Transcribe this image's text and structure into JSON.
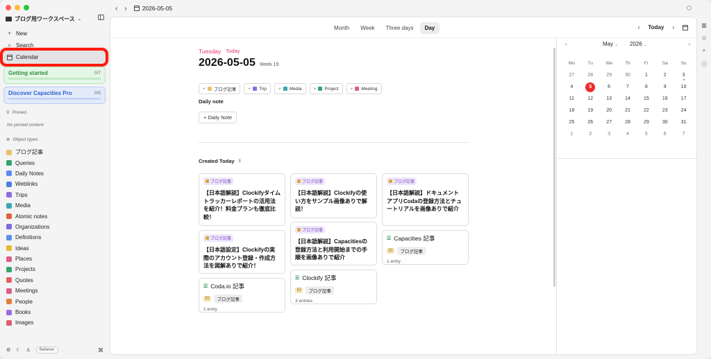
{
  "sidebar": {
    "workspace": "ブログ用ワークスペース",
    "new_label": "New",
    "search_label": "Search",
    "calendar_label": "Calendar",
    "getting_started": {
      "label": "Getting started",
      "count": "0/7"
    },
    "discover": {
      "label": "Discover Capacities Pro",
      "count": "0/5"
    },
    "pinned_header": "Pinned",
    "no_pinned": "No pinned content",
    "object_types_header": "Object types",
    "object_types": [
      {
        "label": "ブログ記事",
        "color": "#e8c170"
      },
      {
        "label": "Queries",
        "color": "#35a56b"
      },
      {
        "label": "Daily Notes",
        "color": "#5b8def"
      },
      {
        "label": "Weblinks",
        "color": "#4d7fe0"
      },
      {
        "label": "Trips",
        "color": "#8b6de0"
      },
      {
        "label": "Media",
        "color": "#3aa9b5"
      },
      {
        "label": "Atomic notes",
        "color": "#e0623c"
      },
      {
        "label": "Organizations",
        "color": "#7d6be0"
      },
      {
        "label": "Definitions",
        "color": "#5b8def"
      },
      {
        "label": "Ideas",
        "color": "#e8b830"
      },
      {
        "label": "Places",
        "color": "#e05c8a"
      },
      {
        "label": "Projects",
        "color": "#35a56b"
      },
      {
        "label": "Quotes",
        "color": "#e06060"
      },
      {
        "label": "Meetings",
        "color": "#e05c8a"
      },
      {
        "label": "People",
        "color": "#e08040"
      },
      {
        "label": "Books",
        "color": "#9b6de0"
      },
      {
        "label": "Images",
        "color": "#e05c70"
      }
    ],
    "footer_badge": "Believer"
  },
  "topbar": {
    "title": "2026-05-05"
  },
  "views": {
    "tabs": [
      "Month",
      "Week",
      "Three days",
      "Day"
    ],
    "active": "Day",
    "today_label": "Today"
  },
  "day": {
    "weekday": "Tuesday",
    "today_badge": "Today",
    "date": "2026-05-05",
    "week": "Week 19",
    "create_chips": [
      {
        "label": "ブログ記事",
        "color": "#e8c170"
      },
      {
        "label": "Trip",
        "color": "#8b6de0"
      },
      {
        "label": "Media",
        "color": "#3aa9b5"
      },
      {
        "label": "Project",
        "color": "#35a56b"
      },
      {
        "label": "Meeting",
        "color": "#e05c8a"
      }
    ],
    "daily_note_header": "Daily note",
    "daily_note_button": "Daily Note",
    "created_today_label": "Created Today",
    "created_today_count": "8"
  },
  "cards": {
    "c1": {
      "tag": "ブログ記事",
      "title": "【日本語解説】Clockifyタイムトラッカーレポートの活用法を紹介！料金プランも徹底比較！"
    },
    "c2": {
      "tag": "ブログ記事",
      "title": "【日本語設定】Clockifyの実際のアカウント登録・作成方法を図解ありで紹介！"
    },
    "c3": {
      "title": "Coda.io 記事",
      "tag_letter": "El",
      "tag": "ブログ記事",
      "count": "1 entry"
    },
    "c4": {
      "tag": "ブログ記事",
      "title": "【日本語解説】Clockifyの使い方をサンプル画像ありで解説！"
    },
    "c5": {
      "tag": "ブログ記事",
      "title": "【日本語解説】Capacitiesの登録方法と利用開始までの手順を画像ありで紹介"
    },
    "c6": {
      "title": "Clockify 記事",
      "tag_letter": "El",
      "tag": "ブログ記事",
      "count": "3 entries"
    },
    "c7": {
      "tag": "ブログ記事",
      "title": "【日本語解説】ドキュメントアプリCodaの登録方法とチュートリアルを画像ありで紹介"
    },
    "c8": {
      "title": "Capacities 記事",
      "tag_letter": "El",
      "tag": "ブログ記事",
      "count": "1 entry"
    }
  },
  "month_calendar": {
    "month": "May",
    "year": "2026",
    "day_headers": [
      "Mo",
      "Tu",
      "We",
      "Th",
      "Fr",
      "Sa",
      "Su"
    ],
    "selected": "5",
    "weeks": [
      [
        "27",
        "28",
        "29",
        "30",
        "1",
        "2",
        "3"
      ],
      [
        "4",
        "5",
        "6",
        "7",
        "8",
        "9",
        "10"
      ],
      [
        "11",
        "12",
        "13",
        "14",
        "15",
        "16",
        "17"
      ],
      [
        "18",
        "19",
        "20",
        "21",
        "22",
        "23",
        "24"
      ],
      [
        "25",
        "26",
        "27",
        "28",
        "29",
        "30",
        "31"
      ],
      [
        "1",
        "2",
        "3",
        "4",
        "5",
        "6",
        "7"
      ]
    ]
  }
}
